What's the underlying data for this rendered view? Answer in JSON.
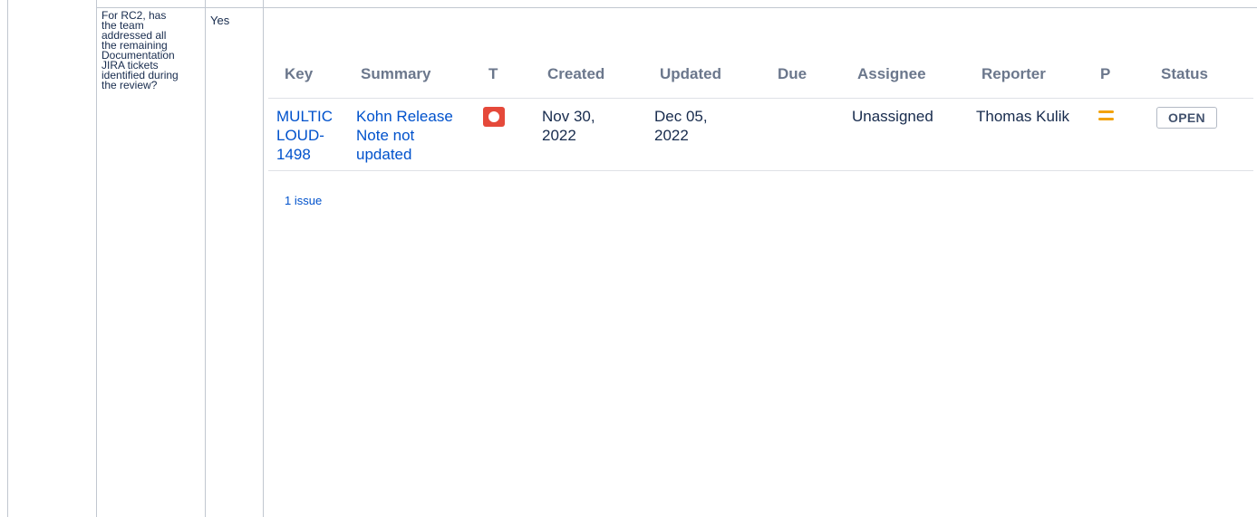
{
  "question_cell": {
    "lines": [
      "For RC2, has",
      "the team",
      "addressed all",
      "the remaining",
      "Documentation",
      "JIRA tickets",
      "identified during",
      "the review?"
    ]
  },
  "answer_cell": "Yes",
  "jira_table": {
    "headers": {
      "key": "Key",
      "summary": "Summary",
      "type": "T",
      "created": "Created",
      "updated": "Updated",
      "due": "Due",
      "assignee": "Assignee",
      "reporter": "Reporter",
      "priority": "P",
      "status": "Status"
    },
    "rows": [
      {
        "key_lines": [
          "MULTIC",
          "LOUD-",
          "1498"
        ],
        "summary_lines": [
          "Kohn Release",
          "Note not",
          "updated"
        ],
        "type_icon": "bug-icon",
        "type_color": "#e5493a",
        "created_lines": [
          "Nov 30,",
          "2022"
        ],
        "updated_lines": [
          "Dec 05,",
          "2022"
        ],
        "due": "",
        "assignee": "Unassigned",
        "reporter": "Thomas Kulik",
        "priority_icon": "priority-medium-icon",
        "priority_color": "#f2a20c",
        "status": "OPEN"
      }
    ],
    "issue_count": "1 issue"
  }
}
